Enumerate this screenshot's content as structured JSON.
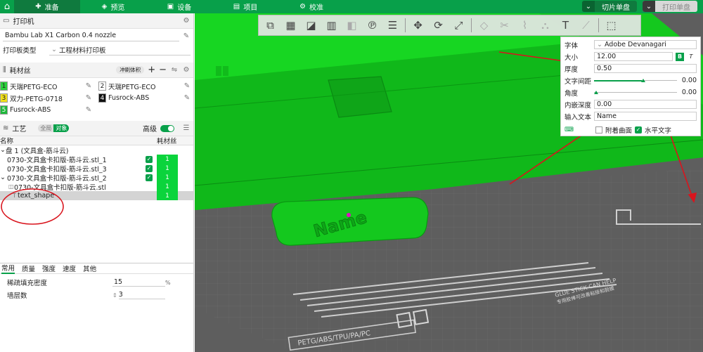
{
  "topbar": {
    "tabs": [
      {
        "label": "准备",
        "icon": "prepare-icon",
        "active": true
      },
      {
        "label": "预览",
        "icon": "preview-icon",
        "active": false
      },
      {
        "label": "设备",
        "icon": "device-icon",
        "active": false
      },
      {
        "label": "项目",
        "icon": "project-icon",
        "active": false
      },
      {
        "label": "校准",
        "icon": "calibrate-icon",
        "active": false
      }
    ],
    "slice_label": "切片单盘",
    "print_label": "打印单盘",
    "accent": "#08a04a"
  },
  "printer": {
    "title": "打印机",
    "preset": "Bambu Lab X1 Carbon 0.4 nozzle",
    "plate_label": "打印板类型",
    "plate_value": "工程材料打印板"
  },
  "filament": {
    "title": "耗材丝",
    "flush_label": "冲刷体积",
    "items": [
      {
        "num": "1",
        "name": "天瑞PETG-ECO",
        "color": "#2bd13d",
        "textColor": "#222"
      },
      {
        "num": "2",
        "name": "天瑞PETG-ECO",
        "color": "#ffffff",
        "textColor": "#222"
      },
      {
        "num": "3",
        "name": "双力-PETG-0718",
        "color": "#f1e01a",
        "textColor": "#222"
      },
      {
        "num": "4",
        "name": "Fusrock-ABS",
        "color": "#111111",
        "textColor": "#fff"
      },
      {
        "num": "5",
        "name": "Fusrock-ABS",
        "color": "#1fb83b",
        "textColor": "#fff"
      }
    ]
  },
  "process": {
    "title": "工艺",
    "toggle_global": "全局",
    "toggle_object": "对象",
    "advanced_label": "高级",
    "col_name": "名称",
    "col_filament": "耗材丝",
    "tree": [
      {
        "label": "盘 1 (文具盒-筋斗云)",
        "indent": 0,
        "check": false,
        "fil": ""
      },
      {
        "label": "0730-文具盒卡扣版-筋斗云.stl_1",
        "indent": 1,
        "check": true,
        "fil": "1"
      },
      {
        "label": "0730-文具盒卡扣版-筋斗云.stl_3",
        "indent": 1,
        "check": true,
        "fil": "1"
      },
      {
        "label": "0730-文具盒卡扣版-筋斗云.stl_2",
        "indent": 1,
        "check": true,
        "fil": "1"
      },
      {
        "label": "0730-文具盒卡扣版-筋斗云.stl",
        "indent": 2,
        "check": false,
        "fil": "1"
      },
      {
        "label": "text_shape",
        "indent": 2,
        "check": false,
        "fil": "1"
      }
    ]
  },
  "settings": {
    "tabs": [
      "常用",
      "质量",
      "强度",
      "速度",
      "其他"
    ],
    "fields": [
      {
        "label": "稀疏填充密度",
        "value": "15",
        "unit": "%"
      },
      {
        "label": "墙层数",
        "value": "3",
        "unit": ""
      }
    ]
  },
  "textpanel": {
    "font_label": "字体",
    "font_value": "Adobe Devanagari",
    "size_label": "大小",
    "size_value": "12.00",
    "bold": "B",
    "italic": "T",
    "thickness_label": "厚度",
    "thickness_value": "0.50",
    "spacing_label": "文字间距",
    "spacing_value": "0.00",
    "angle_label": "角度",
    "angle_value": "0.00",
    "embed_label": "内嵌深度",
    "embed_value": "0.00",
    "input_label": "输入文本",
    "input_value": "Name",
    "attach_label": "附着曲面",
    "horizontal_label": "水平文字"
  },
  "scene": {
    "plate_text": "Name",
    "glue_text": "GLUE STICK CAN HELP",
    "glue_sub": "专用胶棒可改善粘接和脱模",
    "material_text": "PETG/ABS/TPU/PA/PC"
  }
}
